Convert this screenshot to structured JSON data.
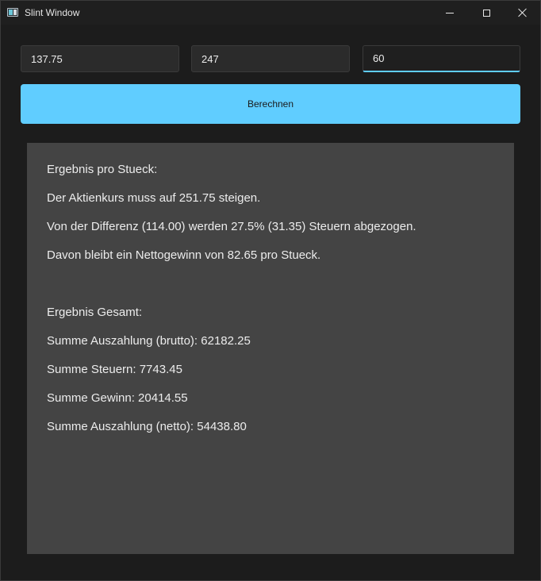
{
  "window": {
    "title": "Slint Window"
  },
  "inputs": {
    "field1_value": "137.75",
    "field2_value": "247",
    "field3_value": "60"
  },
  "button": {
    "label": "Berechnen"
  },
  "results": {
    "per_piece_heading": "Ergebnis pro Stueck:",
    "line_price": "Der Aktienkurs muss auf 251.75 steigen.",
    "line_tax": "Von der Differenz (114.00) werden 27.5% (31.35) Steuern abgezogen.",
    "line_net": "Davon bleibt ein Nettogewinn von 82.65 pro Stueck.",
    "total_heading": "Ergebnis Gesamt:",
    "line_gross": "Summe Auszahlung (brutto): 62182.25",
    "line_taxes": "Summe Steuern: 7743.45",
    "line_profit": "Summe Gewinn: 20414.55",
    "line_payout_net": "Summe Auszahlung (netto): 54438.80"
  },
  "colors": {
    "accent": "#60cdff",
    "panel": "#444444",
    "background": "#1c1c1c"
  },
  "icons": {
    "app": "app-window-icon",
    "minimize": "minimize-icon",
    "maximize": "maximize-icon",
    "close": "close-icon"
  }
}
